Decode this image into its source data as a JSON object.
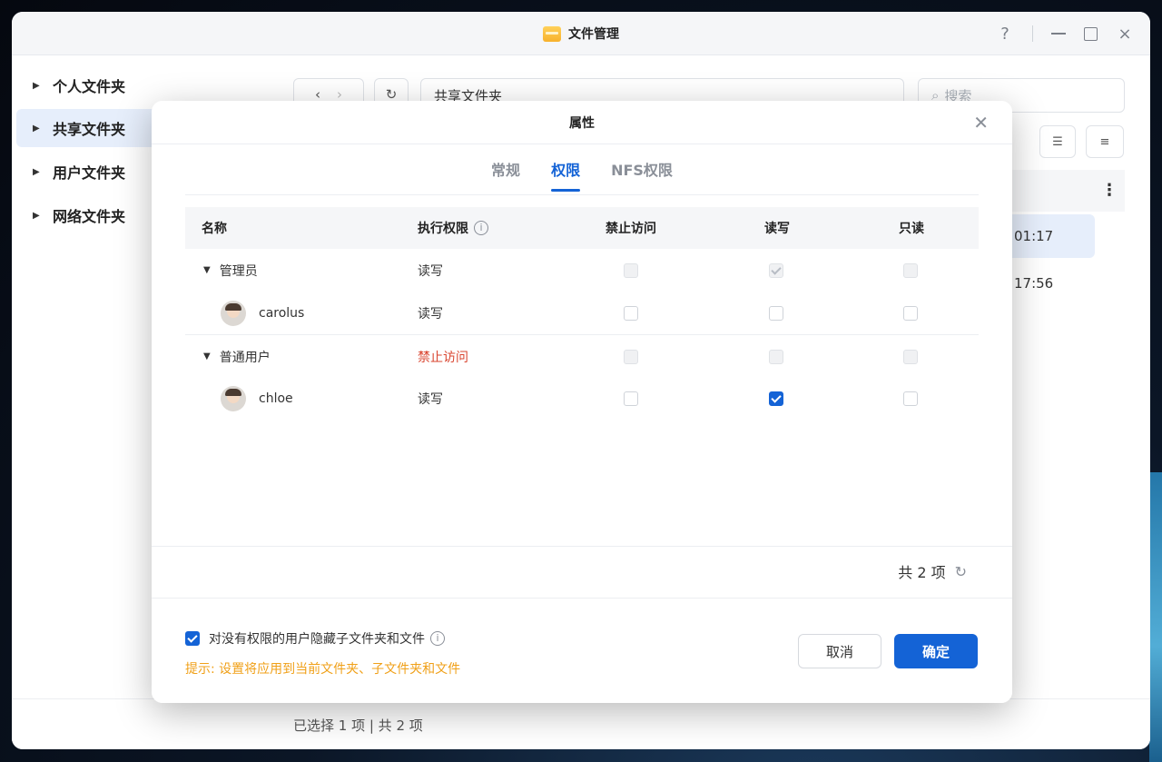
{
  "window": {
    "title": "文件管理",
    "controls": {
      "help": "?",
      "close": "×"
    }
  },
  "sidebar": {
    "items": [
      {
        "label": "个人文件夹",
        "active": false
      },
      {
        "label": "共享文件夹",
        "active": true
      },
      {
        "label": "用户文件夹",
        "active": false
      },
      {
        "label": "网络文件夹",
        "active": false
      }
    ]
  },
  "toolbar": {
    "path": "共享文件夹",
    "search_placeholder": "搜索"
  },
  "file_list": {
    "times": [
      "01:17",
      "17:56"
    ]
  },
  "status": {
    "text": "已选择 1 项 | 共 2 项"
  },
  "dialog": {
    "title": "属性",
    "tabs": [
      {
        "label": "常规",
        "active": false
      },
      {
        "label": "权限",
        "active": true
      },
      {
        "label": "NFS权限",
        "active": false
      }
    ],
    "columns": {
      "name": "名称",
      "effective": "执行权限",
      "deny": "禁止访问",
      "rw": "读写",
      "ro": "只读"
    },
    "rows": [
      {
        "name": "管理员",
        "type": "group",
        "effective": "读写",
        "deny": false,
        "rw": true,
        "ro": false,
        "disabled": true
      },
      {
        "name": "carolus",
        "type": "user",
        "effective": "读写",
        "deny": false,
        "rw": false,
        "ro": false,
        "disabled": false
      },
      {
        "name": "普通用户",
        "type": "group",
        "effective": "禁止访问",
        "deny": false,
        "rw": false,
        "ro": false,
        "disabled": true
      },
      {
        "name": "chloe",
        "type": "user",
        "effective": "读写",
        "deny": false,
        "rw": true,
        "ro": false,
        "disabled": false
      }
    ],
    "count_text": "共 2 项",
    "hide_option": {
      "label": "对没有权限的用户隐藏子文件夹和文件",
      "checked": true
    },
    "hint": "提示: 设置将应用到当前文件夹、子文件夹和文件",
    "cancel_label": "取消",
    "ok_label": "确定"
  },
  "colors": {
    "accent": "#1463d6",
    "denied": "#d9442f",
    "hint": "#f0a018"
  }
}
